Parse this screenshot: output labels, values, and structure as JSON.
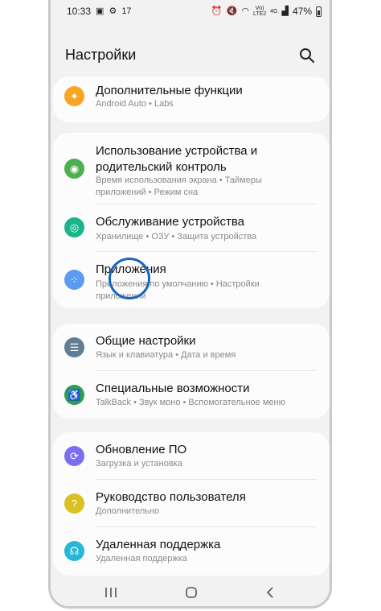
{
  "status": {
    "time": "10:33",
    "notif_count": "17",
    "net_top": "Vo)",
    "net_bottom": "LTE2",
    "net_4g": "4G",
    "battery": "47%"
  },
  "header": {
    "title": "Настройки"
  },
  "groups": [
    {
      "items": [
        {
          "title": "Дополнительные функции",
          "sub": "Android Auto  •  Labs",
          "color": "#f6a623",
          "icon": "puzzle-icon"
        }
      ]
    },
    {
      "items": [
        {
          "title": "Использование устройства и родительский контроль",
          "sub": "Время использования экрана  •  Таймеры приложений  •  Режим сна",
          "color": "#4caf50",
          "icon": "wellbeing-icon"
        },
        {
          "title": "Обслуживание устройства",
          "sub": "Хранилище  •  ОЗУ  •  Защита устройства",
          "color": "#1ab38c",
          "icon": "device-care-icon"
        },
        {
          "title": "Приложения",
          "sub": "Приложения по умолчанию  •  Настройки приложений",
          "color": "#5b9cf0",
          "icon": "apps-icon"
        }
      ]
    },
    {
      "items": [
        {
          "title": "Общие настройки",
          "sub": "Язык и клавиатура  •  Дата и время",
          "color": "#5f7d95",
          "icon": "sliders-icon"
        },
        {
          "title": "Специальные возможности",
          "sub": "TalkBack  •  Звук моно  •  Вспомогательное меню",
          "color": "#2e9e55",
          "icon": "accessibility-icon"
        }
      ]
    },
    {
      "items": [
        {
          "title": "Обновление ПО",
          "sub": "Загрузка и установка",
          "color": "#7a6ff0",
          "icon": "update-icon"
        },
        {
          "title": "Руководство пользователя",
          "sub": "Дополнительно",
          "color": "#d9c21d",
          "icon": "manual-icon"
        },
        {
          "title": "Удаленная поддержка",
          "sub": "Удаленная поддержка",
          "color": "#27b8d8",
          "icon": "headset-icon"
        }
      ]
    }
  ]
}
